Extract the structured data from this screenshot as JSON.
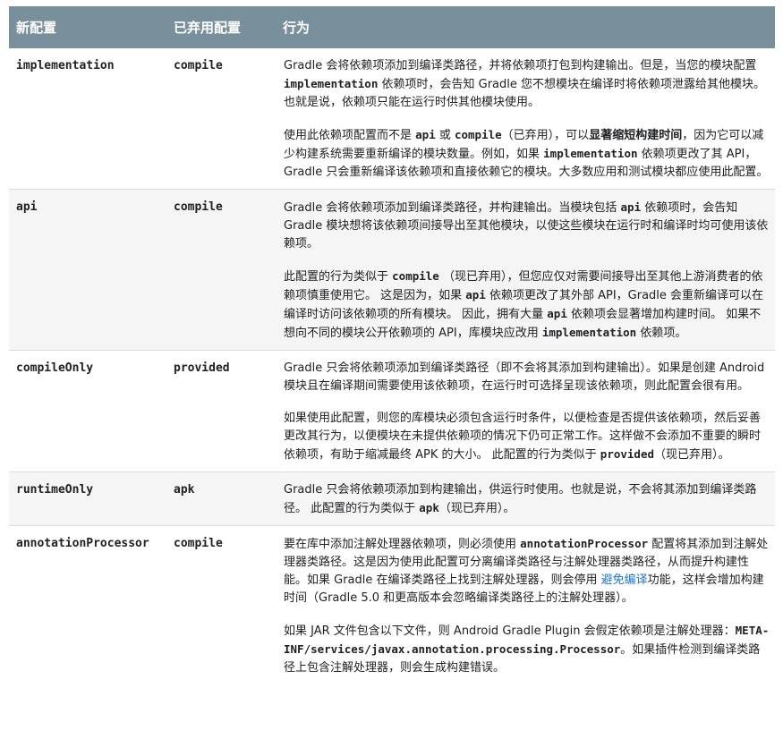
{
  "headers": [
    "新配置",
    "已弃用配置",
    "行为"
  ],
  "rows": [
    {
      "config": "implementation",
      "deprecated": "compile",
      "paras": [
        [
          {
            "t": "Gradle 会将依赖项添加到编译类路径，并将依赖项打包到构建输出。但是，当您的模块配置 "
          },
          {
            "t": "implementation",
            "s": "code"
          },
          {
            "t": " 依赖项时，会告知 Gradle 您不想模块在编译时将依赖项泄露给其他模块。也就是说，依赖项只能在运行时供其他模块使用。"
          }
        ],
        [
          {
            "t": "使用此依赖项配置而不是 "
          },
          {
            "t": "api",
            "s": "code"
          },
          {
            "t": " 或 "
          },
          {
            "t": "compile",
            "s": "code"
          },
          {
            "t": "（已弃用），可以"
          },
          {
            "t": "显著缩短构建时间",
            "s": "bold"
          },
          {
            "t": "，因为它可以减少构建系统需要重新编译的模块数量。例如，如果 "
          },
          {
            "t": "implementation",
            "s": "code"
          },
          {
            "t": " 依赖项更改了其 API，Gradle 只会重新编译该依赖项和直接依赖它的模块。大多数应用和测试模块都应使用此配置。"
          }
        ]
      ]
    },
    {
      "config": "api",
      "deprecated": "compile",
      "paras": [
        [
          {
            "t": "Gradle 会将依赖项添加到编译类路径，并构建输出。当模块包括 "
          },
          {
            "t": "api",
            "s": "code"
          },
          {
            "t": " 依赖项时，会告知 Gradle 模块想将该依赖项间接导出至其他模块，以使这些模块在运行时和编译时均可使用该依赖项。"
          }
        ],
        [
          {
            "t": "此配置的行为类似于 "
          },
          {
            "t": "compile",
            "s": "code"
          },
          {
            "t": " （现已弃用），但您应仅对需要间接导出至其他上游消费者的依赖项慎重使用它。 这是因为，如果 "
          },
          {
            "t": "api",
            "s": "code"
          },
          {
            "t": " 依赖项更改了其外部 API，Gradle 会重新编译可以在编译时访问该依赖项的所有模块。 因此，拥有大量 "
          },
          {
            "t": "api",
            "s": "code"
          },
          {
            "t": " 依赖项会显著增加构建时间。 如果不想向不同的模块公开依赖项的 API，库模块应改用 "
          },
          {
            "t": "implementation",
            "s": "code"
          },
          {
            "t": " 依赖项。"
          }
        ]
      ]
    },
    {
      "config": "compileOnly",
      "deprecated": "provided",
      "paras": [
        [
          {
            "t": "Gradle 只会将依赖项添加到编译类路径（即不会将其添加到构建输出）。如果是创建 Android 模块且在编译期间需要使用该依赖项，在运行时可选择呈现该依赖项，则此配置会很有用。"
          }
        ],
        [
          {
            "t": "如果使用此配置，则您的库模块必须包含运行时条件，以便检查是否提供该依赖项，然后妥善更改其行为，以便模块在未提供依赖项的情况下仍可正常工作。这样做不会添加不重要的瞬时依赖项，有助于缩减最终 APK 的大小。 此配置的行为类似于 "
          },
          {
            "t": "provided",
            "s": "code"
          },
          {
            "t": "（现已弃用）。"
          }
        ]
      ]
    },
    {
      "config": "runtimeOnly",
      "deprecated": "apk",
      "paras": [
        [
          {
            "t": "Gradle 只会将依赖项添加到构建输出，供运行时使用。也就是说，不会将其添加到编译类路径。 此配置的行为类似于 "
          },
          {
            "t": "apk",
            "s": "code"
          },
          {
            "t": "（现已弃用）。"
          }
        ]
      ]
    },
    {
      "config": "annotationProcessor",
      "deprecated": "compile",
      "paras": [
        [
          {
            "t": "要在库中添加注解处理器依赖项，则必须使用 "
          },
          {
            "t": "annotationProcessor",
            "s": "code"
          },
          {
            "t": " 配置将其添加到注解处理器类路径。这是因为使用此配置可分离编译类路径与注解处理器类路径，从而提升构建性能。如果 Gradle 在编译类路径上找到注解处理器，则会停用 "
          },
          {
            "t": "避免编译",
            "s": "link"
          },
          {
            "t": "功能，这样会增加构建时间（Gradle 5.0 和更高版本会忽略编译类路径上的注解处理器）。"
          }
        ],
        [
          {
            "t": "如果 JAR 文件包含以下文件，则 Android Gradle Plugin 会假定依赖项是注解处理器："
          },
          {
            "t": "META-INF/services/javax.annotation.processing.Processor",
            "s": "code"
          },
          {
            "t": "。如果插件检测到编译类路径上包含注解处理器，则会生成构建错误。"
          }
        ]
      ]
    }
  ]
}
